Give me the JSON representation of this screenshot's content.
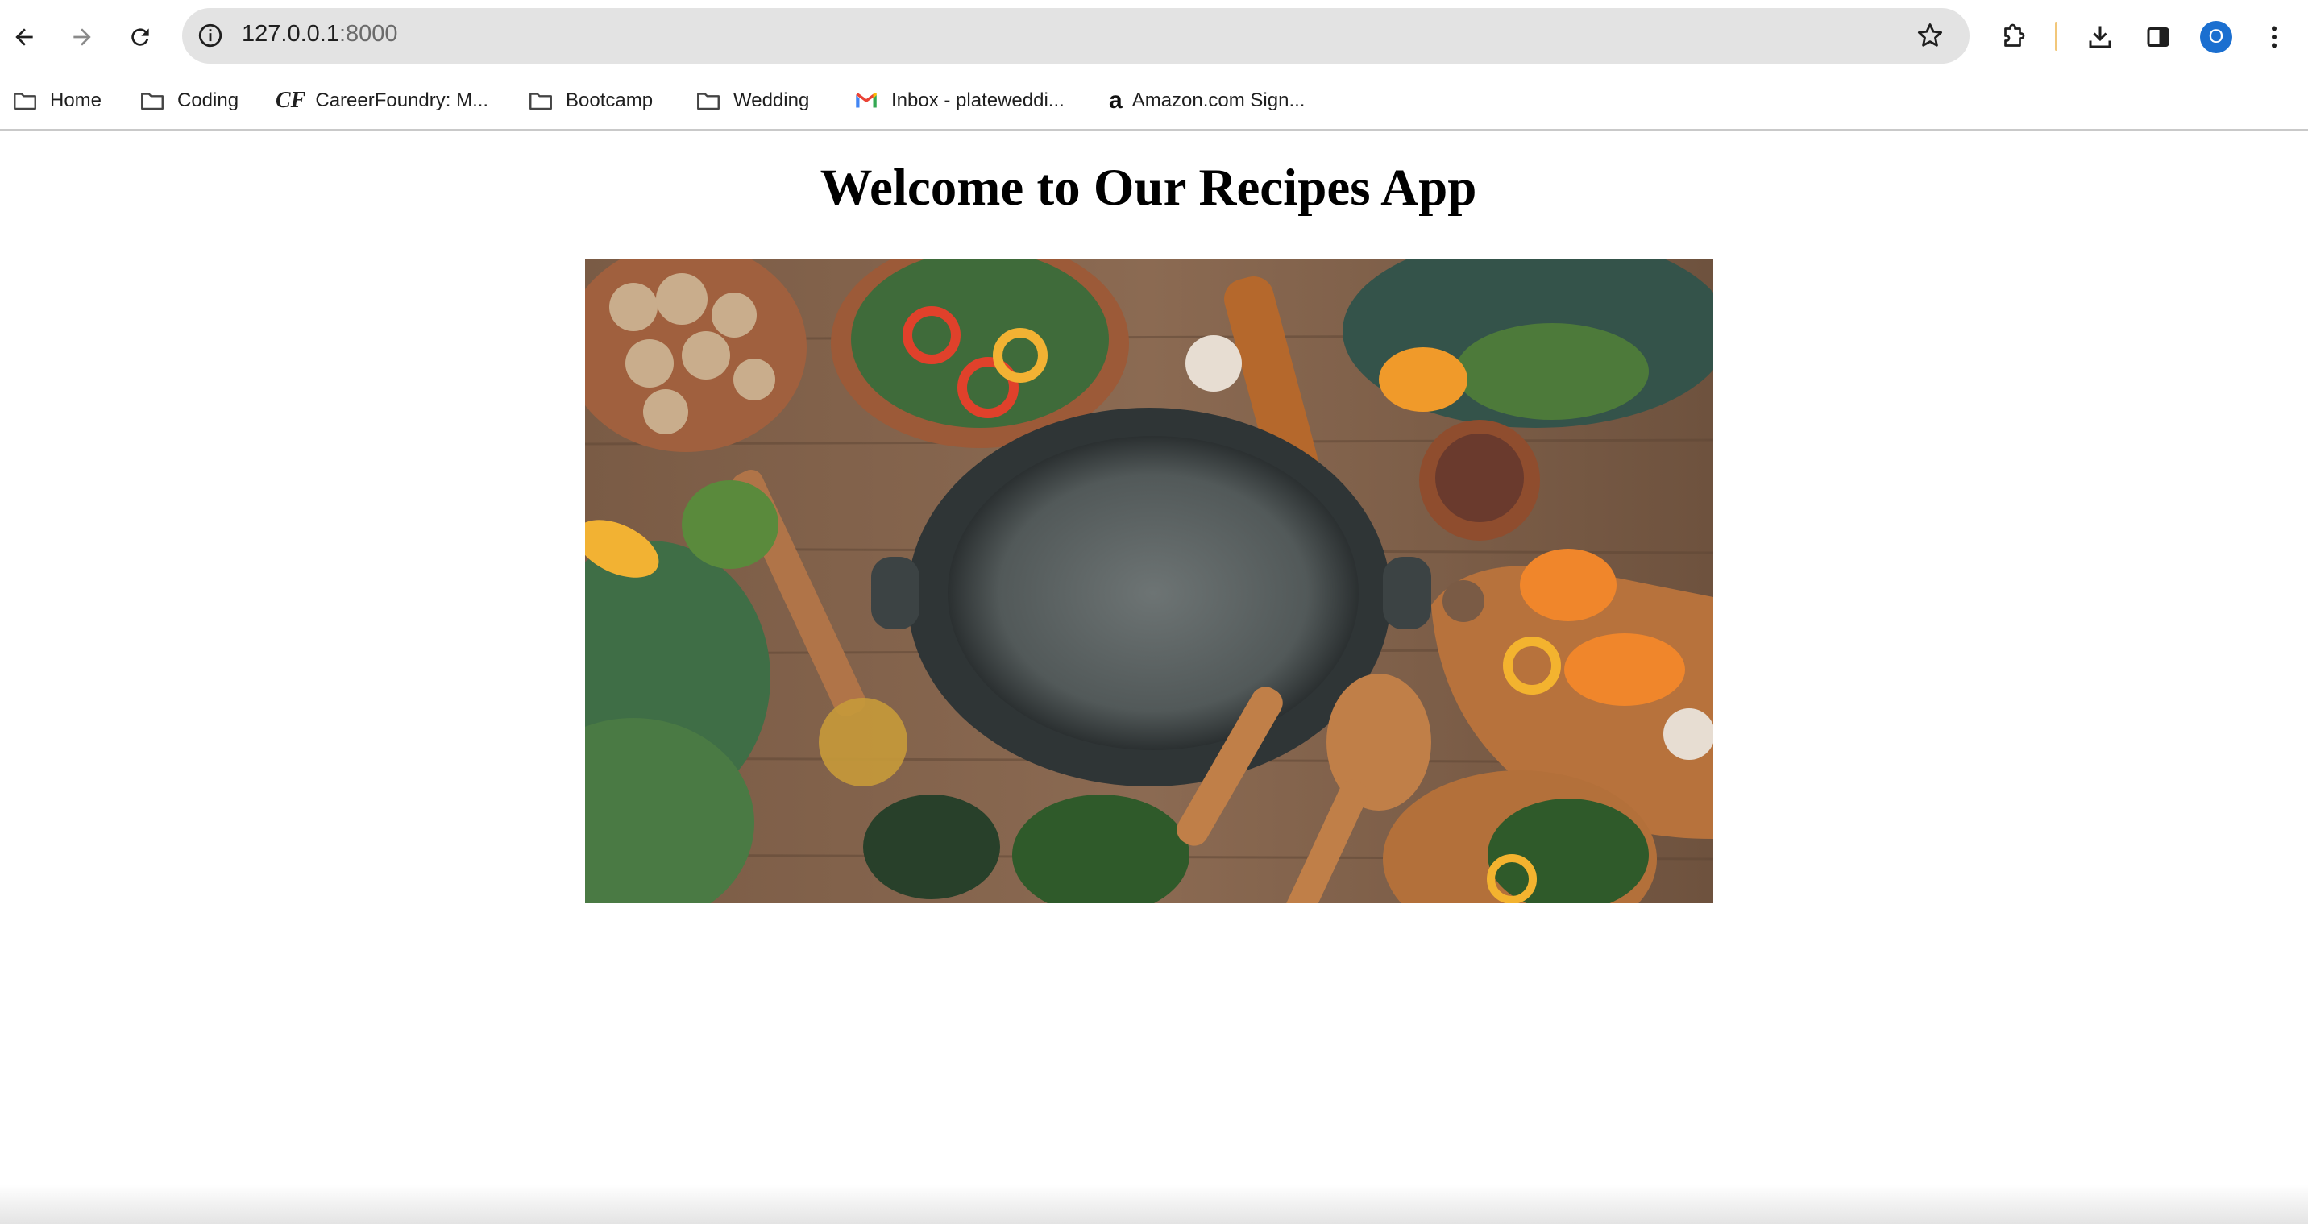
{
  "browser": {
    "url_host": "127.0.0.1",
    "url_port": ":8000",
    "avatar_letter": "O",
    "icons": [
      "back-arrow-icon",
      "forward-arrow-icon",
      "reload-icon",
      "site-info-icon",
      "bookmark-star-icon",
      "extensions-puzzle-icon",
      "download-icon",
      "side-panel-icon",
      "kebab-menu-icon"
    ]
  },
  "bookmarks": [
    {
      "label": "Home",
      "icon": "folder-icon"
    },
    {
      "label": "Coding",
      "icon": "folder-icon"
    },
    {
      "label": "CareerFoundry: M...",
      "icon": "careerfoundry-logo-icon",
      "glyph": "CF"
    },
    {
      "label": "Bootcamp",
      "icon": "folder-icon"
    },
    {
      "label": "Wedding",
      "icon": "folder-icon"
    },
    {
      "label": "Inbox - plateweddi...",
      "icon": "gmail-icon"
    },
    {
      "label": "Amazon.com Sign...",
      "icon": "amazon-icon",
      "glyph": "a"
    }
  ],
  "page": {
    "title": "Welcome to Our Recipes App",
    "hero_image": "cooking-ingredients-photo"
  }
}
